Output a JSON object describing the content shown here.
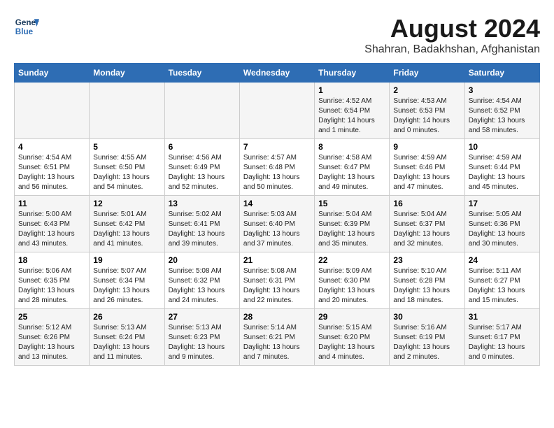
{
  "header": {
    "logo_line1": "General",
    "logo_line2": "Blue",
    "title": "August 2024",
    "subtitle": "Shahran, Badakhshan, Afghanistan"
  },
  "calendar": {
    "days_of_week": [
      "Sunday",
      "Monday",
      "Tuesday",
      "Wednesday",
      "Thursday",
      "Friday",
      "Saturday"
    ],
    "weeks": [
      [
        {
          "day": "",
          "info": ""
        },
        {
          "day": "",
          "info": ""
        },
        {
          "day": "",
          "info": ""
        },
        {
          "day": "",
          "info": ""
        },
        {
          "day": "1",
          "info": "Sunrise: 4:52 AM\nSunset: 6:54 PM\nDaylight: 14 hours\nand 1 minute."
        },
        {
          "day": "2",
          "info": "Sunrise: 4:53 AM\nSunset: 6:53 PM\nDaylight: 14 hours\nand 0 minutes."
        },
        {
          "day": "3",
          "info": "Sunrise: 4:54 AM\nSunset: 6:52 PM\nDaylight: 13 hours\nand 58 minutes."
        }
      ],
      [
        {
          "day": "4",
          "info": "Sunrise: 4:54 AM\nSunset: 6:51 PM\nDaylight: 13 hours\nand 56 minutes."
        },
        {
          "day": "5",
          "info": "Sunrise: 4:55 AM\nSunset: 6:50 PM\nDaylight: 13 hours\nand 54 minutes."
        },
        {
          "day": "6",
          "info": "Sunrise: 4:56 AM\nSunset: 6:49 PM\nDaylight: 13 hours\nand 52 minutes."
        },
        {
          "day": "7",
          "info": "Sunrise: 4:57 AM\nSunset: 6:48 PM\nDaylight: 13 hours\nand 50 minutes."
        },
        {
          "day": "8",
          "info": "Sunrise: 4:58 AM\nSunset: 6:47 PM\nDaylight: 13 hours\nand 49 minutes."
        },
        {
          "day": "9",
          "info": "Sunrise: 4:59 AM\nSunset: 6:46 PM\nDaylight: 13 hours\nand 47 minutes."
        },
        {
          "day": "10",
          "info": "Sunrise: 4:59 AM\nSunset: 6:44 PM\nDaylight: 13 hours\nand 45 minutes."
        }
      ],
      [
        {
          "day": "11",
          "info": "Sunrise: 5:00 AM\nSunset: 6:43 PM\nDaylight: 13 hours\nand 43 minutes."
        },
        {
          "day": "12",
          "info": "Sunrise: 5:01 AM\nSunset: 6:42 PM\nDaylight: 13 hours\nand 41 minutes."
        },
        {
          "day": "13",
          "info": "Sunrise: 5:02 AM\nSunset: 6:41 PM\nDaylight: 13 hours\nand 39 minutes."
        },
        {
          "day": "14",
          "info": "Sunrise: 5:03 AM\nSunset: 6:40 PM\nDaylight: 13 hours\nand 37 minutes."
        },
        {
          "day": "15",
          "info": "Sunrise: 5:04 AM\nSunset: 6:39 PM\nDaylight: 13 hours\nand 35 minutes."
        },
        {
          "day": "16",
          "info": "Sunrise: 5:04 AM\nSunset: 6:37 PM\nDaylight: 13 hours\nand 32 minutes."
        },
        {
          "day": "17",
          "info": "Sunrise: 5:05 AM\nSunset: 6:36 PM\nDaylight: 13 hours\nand 30 minutes."
        }
      ],
      [
        {
          "day": "18",
          "info": "Sunrise: 5:06 AM\nSunset: 6:35 PM\nDaylight: 13 hours\nand 28 minutes."
        },
        {
          "day": "19",
          "info": "Sunrise: 5:07 AM\nSunset: 6:34 PM\nDaylight: 13 hours\nand 26 minutes."
        },
        {
          "day": "20",
          "info": "Sunrise: 5:08 AM\nSunset: 6:32 PM\nDaylight: 13 hours\nand 24 minutes."
        },
        {
          "day": "21",
          "info": "Sunrise: 5:08 AM\nSunset: 6:31 PM\nDaylight: 13 hours\nand 22 minutes."
        },
        {
          "day": "22",
          "info": "Sunrise: 5:09 AM\nSunset: 6:30 PM\nDaylight: 13 hours\nand 20 minutes."
        },
        {
          "day": "23",
          "info": "Sunrise: 5:10 AM\nSunset: 6:28 PM\nDaylight: 13 hours\nand 18 minutes."
        },
        {
          "day": "24",
          "info": "Sunrise: 5:11 AM\nSunset: 6:27 PM\nDaylight: 13 hours\nand 15 minutes."
        }
      ],
      [
        {
          "day": "25",
          "info": "Sunrise: 5:12 AM\nSunset: 6:26 PM\nDaylight: 13 hours\nand 13 minutes."
        },
        {
          "day": "26",
          "info": "Sunrise: 5:13 AM\nSunset: 6:24 PM\nDaylight: 13 hours\nand 11 minutes."
        },
        {
          "day": "27",
          "info": "Sunrise: 5:13 AM\nSunset: 6:23 PM\nDaylight: 13 hours\nand 9 minutes."
        },
        {
          "day": "28",
          "info": "Sunrise: 5:14 AM\nSunset: 6:21 PM\nDaylight: 13 hours\nand 7 minutes."
        },
        {
          "day": "29",
          "info": "Sunrise: 5:15 AM\nSunset: 6:20 PM\nDaylight: 13 hours\nand 4 minutes."
        },
        {
          "day": "30",
          "info": "Sunrise: 5:16 AM\nSunset: 6:19 PM\nDaylight: 13 hours\nand 2 minutes."
        },
        {
          "day": "31",
          "info": "Sunrise: 5:17 AM\nSunset: 6:17 PM\nDaylight: 13 hours\nand 0 minutes."
        }
      ]
    ]
  }
}
